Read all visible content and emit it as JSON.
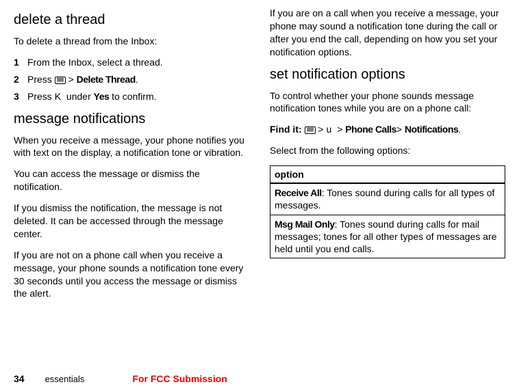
{
  "left": {
    "h_delete": "delete a thread",
    "p_delete_intro": "To delete a thread from the Inbox:",
    "steps": [
      "From the Inbox, select a thread.",
      "Press ",
      "Press "
    ],
    "step2_after_icon": " > ",
    "step2_bold": "Delete Thread",
    "step2_end": ".",
    "step3_k": "K",
    "step3_mid": " under ",
    "step3_bold": "Yes",
    "step3_end": " to confirm.",
    "h_msgnotif": "message notifications",
    "p_mn1": "When you receive a message, your phone notifies you with text on the display, a notification tone or vibration.",
    "p_mn2": "You can access the message or dismiss the notification.",
    "p_mn3": "If you dismiss the notification, the message is not deleted. It can be accessed through the message center.",
    "p_mn4": "If you are not on a phone call when you receive a message, your phone sounds a notification tone every 30 seconds until you access the message or dismiss the alert."
  },
  "right": {
    "p_top": "If you are on a call when you receive a message, your phone may sound a notification tone during the call or after you end the call, depending on how you set your notification options.",
    "h_setnotif": "set notification options",
    "p_sn1": "To control whether your phone sounds message notification tones while you are on a phone call:",
    "findit_label": "Find it: ",
    "findit_gt1": " > ",
    "findit_u": "u",
    "findit_gt2": " > ",
    "findit_b1": "Phone Calls",
    "findit_gt3": "> ",
    "findit_b2": "Notifications",
    "findit_end": ".",
    "p_select": "Select from the following options:",
    "table": {
      "header": "option",
      "row1_bold": "Receive All",
      "row1_rest": ": Tones sound during calls for all types of messages.",
      "row2_bold": "Msg Mail Only",
      "row2_rest": ": Tones sound during calls for mail messages; tones for all other types of messages are held until you end calls."
    }
  },
  "footer": {
    "page": "34",
    "section": "essentials",
    "fcc": "For FCC Submission"
  }
}
